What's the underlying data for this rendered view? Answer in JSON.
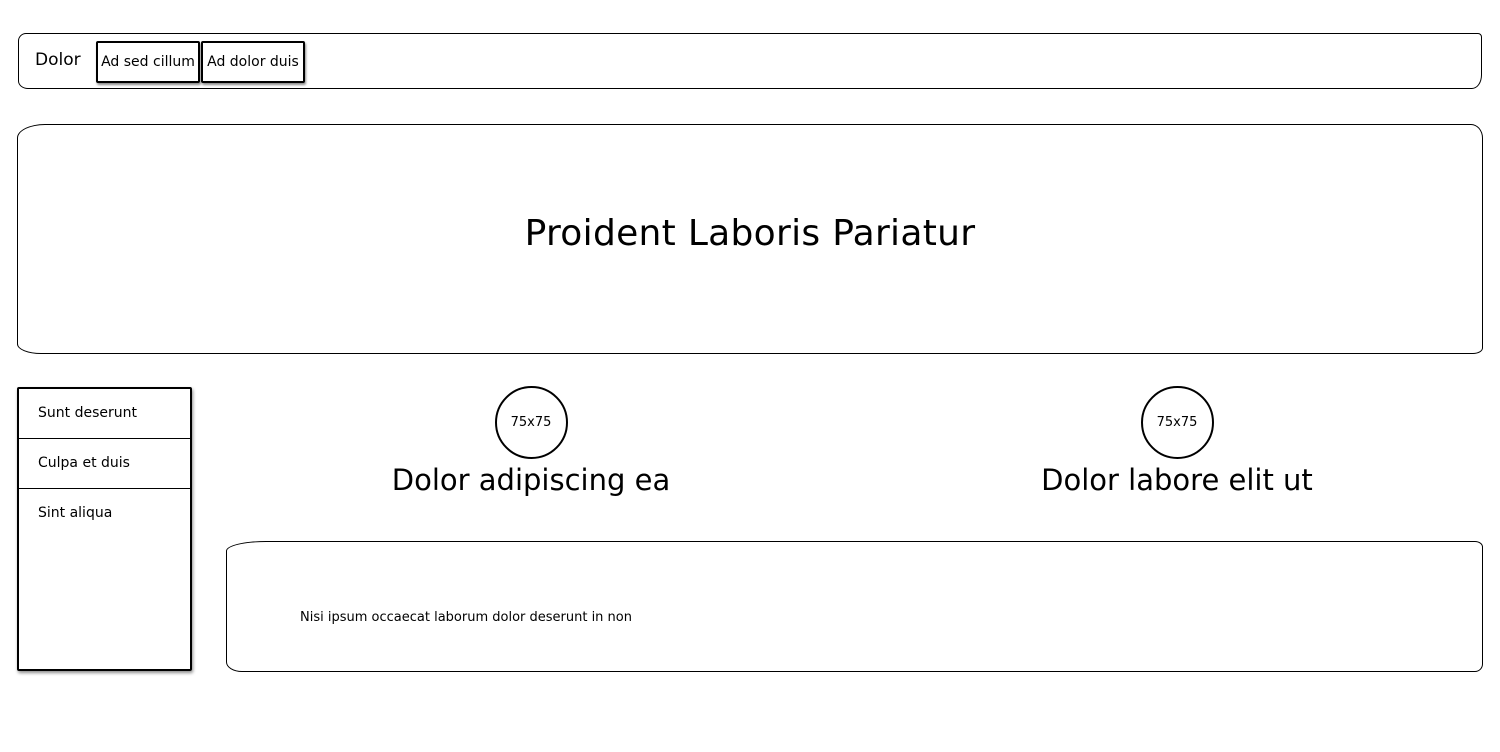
{
  "navbar": {
    "brand": "Dolor",
    "buttons": [
      {
        "label": "Ad sed cillum"
      },
      {
        "label": "Ad dolor duis"
      }
    ]
  },
  "hero": {
    "title": "Proident Laboris Pariatur"
  },
  "sidebar": {
    "items": [
      {
        "label": "Sunt deserunt"
      },
      {
        "label": "Culpa et duis"
      },
      {
        "label": "Sint aliqua"
      }
    ]
  },
  "features": [
    {
      "image_label": "75x75",
      "title": "Dolor adipiscing ea"
    },
    {
      "image_label": "75x75",
      "title": "Dolor labore elit ut"
    }
  ],
  "content": {
    "text": "Nisi ipsum occaecat laborum dolor deserunt in non"
  }
}
